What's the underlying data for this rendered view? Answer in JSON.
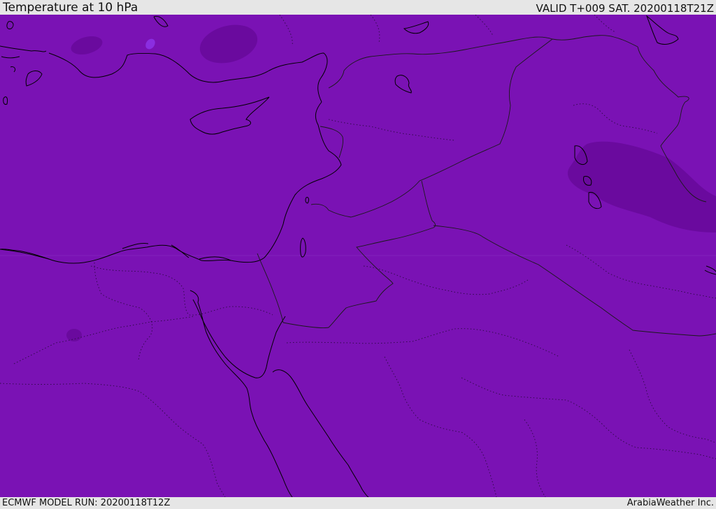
{
  "header": {
    "title": "Temperature at 10 hPa",
    "valid": "VALID T+009 SAT. 20200118T21Z"
  },
  "footer": {
    "model_run": "ECMWF MODEL RUN: 20200118T12Z",
    "credit": "ArabiaWeather Inc."
  },
  "colors": {
    "field_base": "#7a12b4",
    "field_cold": "#6a0a9e",
    "field_warm_spot": "#8a2ee0",
    "coastline": "#000000",
    "border": "#222222",
    "chrome": "#e6e6e6"
  }
}
